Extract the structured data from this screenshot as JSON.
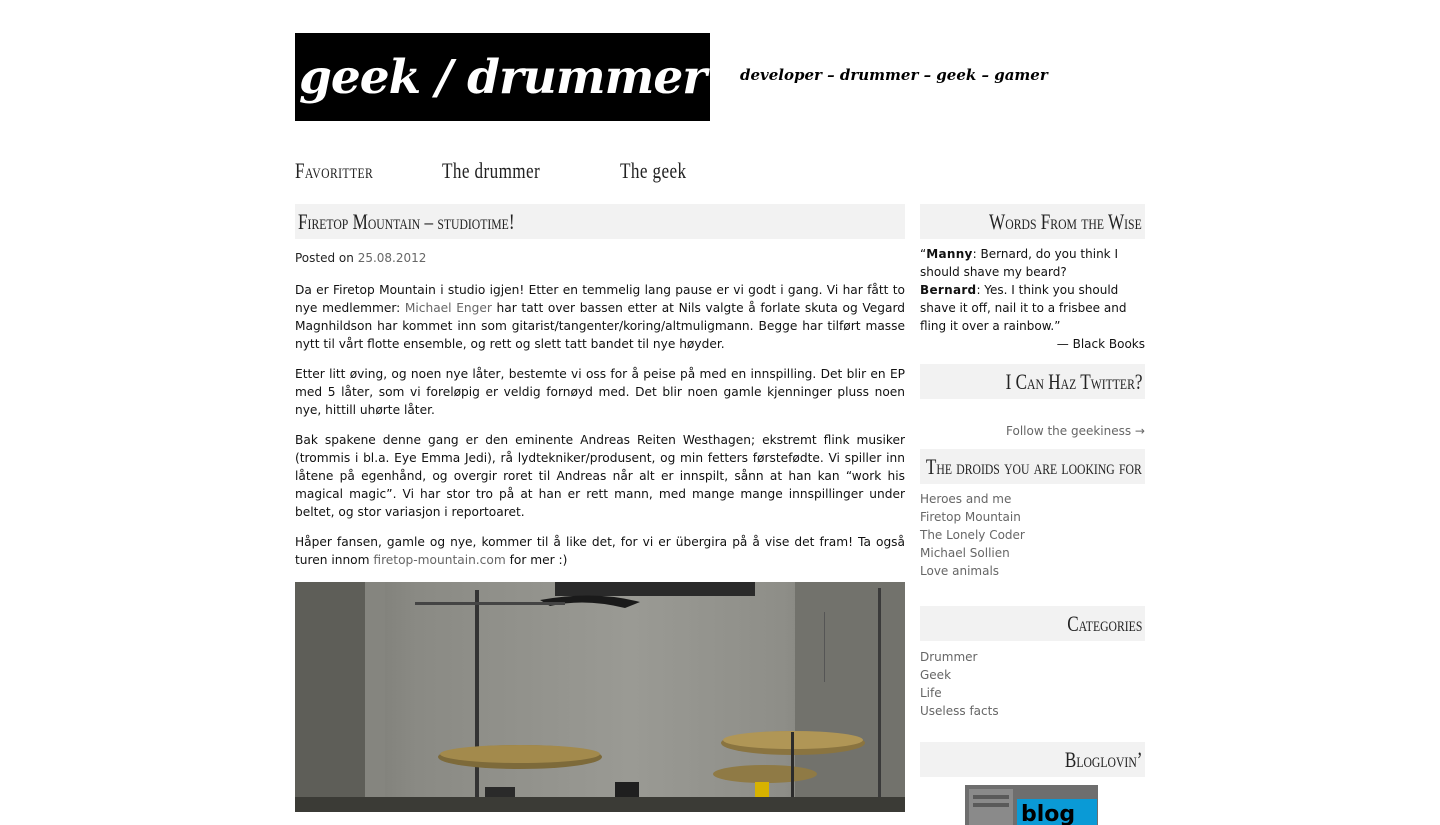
{
  "site": {
    "title": "geek / drummer",
    "tagline": "developer – drummer – geek – gamer"
  },
  "nav": {
    "items": [
      {
        "label": "Favoritter"
      },
      {
        "label": "The drummer"
      },
      {
        "label": "The geek"
      }
    ]
  },
  "post": {
    "title": "Firetop Mountain – studiotime!",
    "posted_on_label": "Posted on",
    "date": "25.08.2012",
    "p1_before": "Da er Firetop Mountain i studio igjen! Etter en temmelig lang pause er vi godt i gang. Vi har fått to nye medlemmer: ",
    "p1_link": "Michael Enger",
    "p1_after": " har tatt over bassen etter at Nils valgte å forlate skuta og Vegard Magnhildson har kommet inn som gitarist/tangenter/koring/altmuligmann. Begge har tilført masse nytt til vårt flotte ensemble, og rett og slett tatt bandet til nye høyder.",
    "p2": "Etter litt øving, og noen nye låter, bestemte vi oss for å peise på med en innspilling. Det blir en EP med 5 låter, som vi foreløpig er veldig fornøyd med. Det blir noen gamle kjenninger pluss noen nye, hittill uhørte låter.",
    "p3": "Bak spakene denne gang er den eminente Andreas Reiten Westhagen; ekstremt flink musiker (trommis i bl.a. Eye Emma Jedi), rå lydtekniker/produsent, og min fetters førstefødte. Vi spiller inn låtene på egenhånd, og overgir roret til Andreas når alt er innspilt, sånn at han kan “work his magical magic”. Vi har stor tro på at han er rett mann, med mange mange innspillinger under beltet, og stor variasjon i reportoaret.",
    "p4_before": "Håper fansen, gamle og nye, kommer til å like det, for vi er übergira på å vise det fram! Ta også turen innom ",
    "p4_link": "firetop-mountain.com",
    "p4_after": " for mer :)"
  },
  "sidebar": {
    "wise": {
      "title": "Words From the Wise",
      "speaker1": "Manny",
      "line1": ": Bernard, do you think I should shave my beard?",
      "speaker2": "Bernard",
      "line2": ": Yes. I think you should shave it off, nail it to a frisbee and fling it over a rainbow.”",
      "open_quote": "“",
      "attribution": "— Black Books"
    },
    "twitter": {
      "title": "I Can Haz Twitter?",
      "follow_label": "Follow the geekiness →"
    },
    "droids": {
      "title": "The droids you are looking for",
      "links": [
        "Heroes and me",
        "Firetop Mountain",
        "The Lonely Coder",
        "Michael Sollien",
        "Love animals"
      ]
    },
    "categories": {
      "title": "Categories",
      "links": [
        "Drummer",
        "Geek",
        "Life",
        "Useless facts"
      ]
    },
    "bloglovin": {
      "title": "Bloglovin’",
      "badge_text": "blog"
    }
  },
  "colors": {
    "link": "#666666",
    "title_bar": "#f2f2f2",
    "logo_bg": "#000000"
  }
}
